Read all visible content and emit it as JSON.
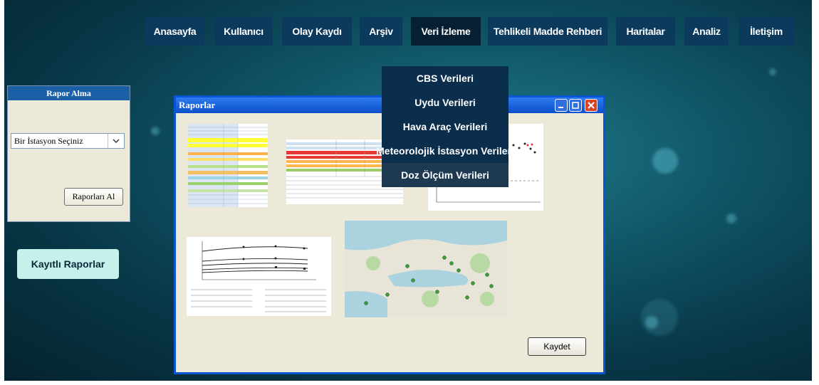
{
  "nav": {
    "items": [
      "Anasayfa",
      "Kullanıcı",
      "Olay Kaydı",
      "Arşiv",
      "Veri İzleme",
      "Tehlikeli Madde Rehberi",
      "Haritalar",
      "Analiz",
      "İletişim"
    ],
    "active_index": 4
  },
  "dropdown": {
    "items": [
      "CBS Verileri",
      "Uydu Verileri",
      "Hava Araç Verileri",
      "Meteorolojik İstasyon Verileri",
      "Doz Ölçüm Verileri"
    ],
    "hover_index": 4
  },
  "rapor_panel": {
    "title": "Rapor Alma",
    "select_value": "Bir İstasyon Seçiniz",
    "button_label": "Raporları Al"
  },
  "kayitli_label": "Kayıtlı Raporlar",
  "window": {
    "title": "Raporlar",
    "save_label": "Kaydet"
  },
  "colors": {
    "nav_bg": "#0b3a5c",
    "window_border": "#0a55d6",
    "kayitli_bg": "#c4f1ea"
  }
}
